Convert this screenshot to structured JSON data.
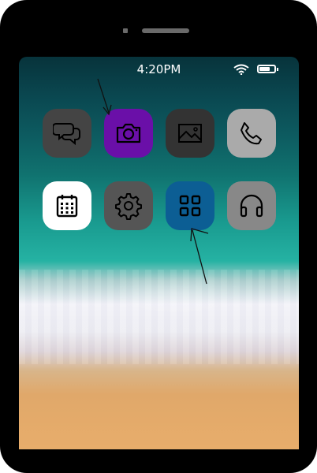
{
  "status_bar": {
    "time": "4:20PM",
    "wifi_icon": "wifi-icon",
    "battery_icon": "battery-icon",
    "battery_level": 0.7
  },
  "apps": [
    {
      "id": "messages",
      "icon": "chat-bubbles-icon",
      "color": "#444444"
    },
    {
      "id": "camera",
      "icon": "camera-icon",
      "color": "#6a0fa8"
    },
    {
      "id": "photos",
      "icon": "image-icon",
      "color": "#333333"
    },
    {
      "id": "phone",
      "icon": "phone-icon",
      "color": "#aaaaaa"
    },
    {
      "id": "calendar",
      "icon": "calendar-icon",
      "color": "#ffffff"
    },
    {
      "id": "settings",
      "icon": "gear-icon",
      "color": "#555555"
    },
    {
      "id": "apps",
      "icon": "grid-icon",
      "color": "#0c5e94"
    },
    {
      "id": "music",
      "icon": "headphones-icon",
      "color": "#888888"
    }
  ],
  "annotations": [
    {
      "icon": "arrow-icon",
      "target": "camera"
    },
    {
      "icon": "arrow-icon",
      "target": "apps"
    }
  ]
}
